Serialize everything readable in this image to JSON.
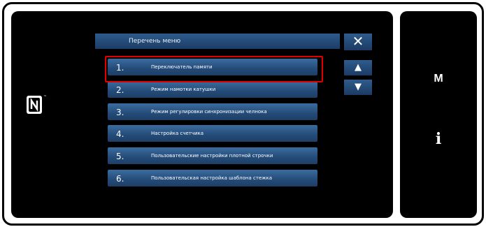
{
  "header": {
    "title": "Перечень меню"
  },
  "buttons": {
    "close_icon": "close-icon",
    "close_glyph": "✕",
    "scroll_up_glyph": "▲",
    "scroll_down_glyph": "▼"
  },
  "menu": {
    "selected_index": 0,
    "items": [
      {
        "number": "1.",
        "label": "Переключатель памяти"
      },
      {
        "number": "2.",
        "label": "Режим намотки катушки"
      },
      {
        "number": "3.",
        "label": "Режим регулировки синхронизации челнока"
      },
      {
        "number": "4.",
        "label": "Настройка счетчика"
      },
      {
        "number": "5.",
        "label": "Пользовательские настройки плотной строчки"
      },
      {
        "number": "6.",
        "label": "Пользовательская настройка шаблона стежка"
      }
    ]
  },
  "side_buttons": {
    "mode_label": "M",
    "info_label": "i"
  },
  "nfc": {
    "icon": "nfc-icon",
    "trademark": "™"
  },
  "colors": {
    "selected_outline": "#e00000",
    "item_blue": "#244b78",
    "screen": "#000000"
  }
}
